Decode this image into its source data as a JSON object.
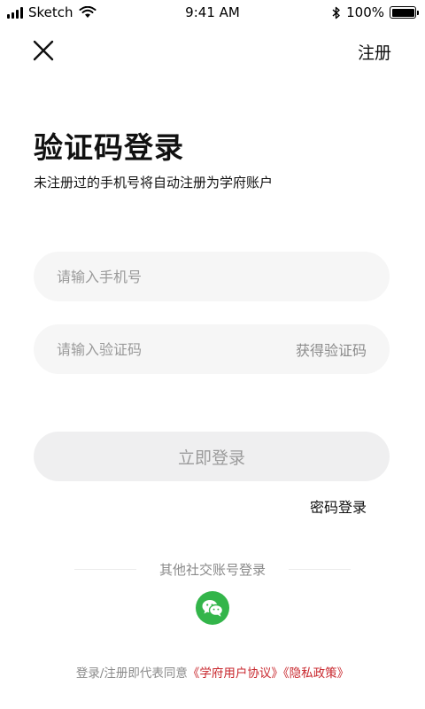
{
  "status_bar": {
    "carrier": "Sketch",
    "time": "9:41 AM",
    "battery": "100%"
  },
  "nav": {
    "close_icon": "close-icon",
    "register_label": "注册"
  },
  "header": {
    "title": "验证码登录",
    "subtitle": "未注册过的手机号将自动注册为学府账户"
  },
  "form": {
    "phone_placeholder": "请输入手机号",
    "code_placeholder": "请输入验证码",
    "get_code_label": "获得验证码",
    "login_label": "立即登录",
    "password_login_label": "密码登录"
  },
  "social": {
    "label": "其他社交账号登录",
    "wechat_icon": "wechat-icon",
    "wechat_color": "#33b54a"
  },
  "agreement": {
    "prefix": "登录/注册即代表同意",
    "user_agreement": "《学府用户协议》",
    "privacy_policy": "《隐私政策》",
    "link_color": "#c8262c"
  }
}
